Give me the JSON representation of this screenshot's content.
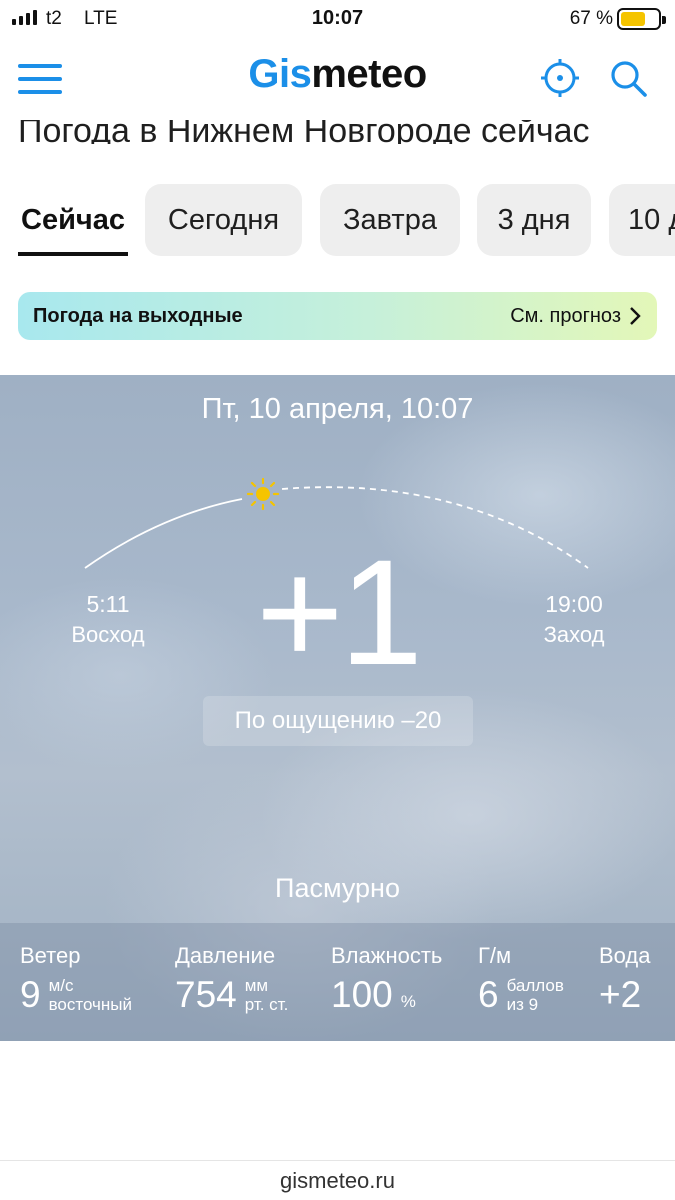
{
  "status_bar": {
    "carrier": "t2",
    "network": "LTE",
    "time": "10:07",
    "battery_percent": "67 %",
    "battery_level": 0.67
  },
  "header": {
    "logo_part1": "Gis",
    "logo_part2": "meteo",
    "brand_color": "#1b8fe8"
  },
  "page_title": "Погода в Нижнем Новгороде сейчас",
  "tabs": [
    {
      "label": "Сейчас",
      "active": true
    },
    {
      "label": "Сегодня",
      "active": false
    },
    {
      "label": "Завтра",
      "active": false
    },
    {
      "label": "3 дня",
      "active": false
    },
    {
      "label": "10 д",
      "active": false
    }
  ],
  "weekend_banner": {
    "title": "Погода на выходные",
    "link": "См. прогноз"
  },
  "weather": {
    "date": "Пт, 10 апреля, 10:07",
    "sunrise_time": "5:11",
    "sunrise_label": "Восход",
    "sunset_time": "19:00",
    "sunset_label": "Заход",
    "temperature": "+1",
    "feels_like": "По ощущению –20",
    "condition": "Пасмурно"
  },
  "metrics": {
    "wind": {
      "label": "Ветер",
      "value": "9",
      "unit_top": "м/с",
      "unit_bottom": "восточный"
    },
    "pressure": {
      "label": "Давление",
      "value": "754",
      "unit_top": "мм",
      "unit_bottom": "рт. ст."
    },
    "humidity": {
      "label": "Влажность",
      "value": "100",
      "unit": "%"
    },
    "geomagnetic": {
      "label": "Г/м",
      "value": "6",
      "unit_top": "баллов",
      "unit_bottom": "из 9"
    },
    "water": {
      "label": "Вода",
      "value": "+2"
    }
  },
  "footer": {
    "domain": "gismeteo.ru"
  }
}
